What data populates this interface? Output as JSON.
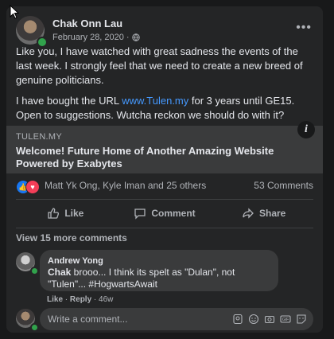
{
  "post": {
    "author": "Chak Onn Lau",
    "date": "February 28, 2020",
    "privacy_icon": "globe-icon",
    "paragraph1": "Like you, I have watched with great sadness the events of the last week. I strongly feel that we need to create a new breed of genuine politicians.",
    "paragraph2_before": "I have bought the URL ",
    "paragraph2_link": "www.Tulen.my",
    "paragraph2_after": " for 3 years until GE15. Open to suggestions. Wutcha reckon we should do with it?"
  },
  "preview": {
    "domain": "TULEN.MY",
    "title": "Welcome! Future Home of Another Amazing Website Powered by Exabytes",
    "info_symbol": "i"
  },
  "reactions": {
    "names": "Matt Yk Ong, Kyle Iman and 25 others",
    "comments": "53 Comments"
  },
  "actions": {
    "like": "Like",
    "comment": "Comment",
    "share": "Share"
  },
  "view_more": "View 15 more comments",
  "comment": {
    "author": "Andrew Yong",
    "mention": "Chak",
    "text": " brooo... I think its spelt as \"Dulan\", not \"Tulen\"... #HogwartsAwait",
    "like": "Like",
    "reply": "Reply",
    "time": "46w"
  },
  "write": {
    "placeholder": "Write a comment...",
    "gif": "GIF"
  }
}
